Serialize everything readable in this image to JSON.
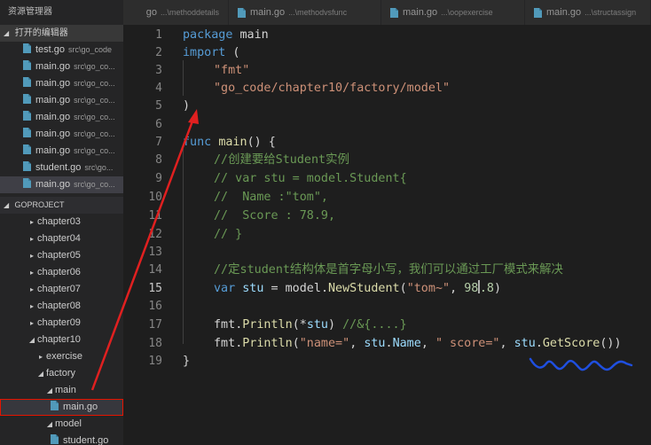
{
  "sidebar": {
    "header": "资源管理器",
    "open_editors_title": "打开的编辑器",
    "open_editors": [
      {
        "name": "test.go",
        "desc": "src\\go_code"
      },
      {
        "name": "main.go",
        "desc": "src\\go_co..."
      },
      {
        "name": "main.go",
        "desc": "src\\go_co..."
      },
      {
        "name": "main.go",
        "desc": "src\\go_co..."
      },
      {
        "name": "main.go",
        "desc": "src\\go_co..."
      },
      {
        "name": "main.go",
        "desc": "src\\go_co..."
      },
      {
        "name": "main.go",
        "desc": "src\\go_co..."
      },
      {
        "name": "student.go",
        "desc": "src\\go..."
      },
      {
        "name": "main.go",
        "desc": "src\\go_co..."
      }
    ],
    "project_title": "GOPROJECT",
    "tree": [
      {
        "label": "chapter03",
        "arrow": "▸"
      },
      {
        "label": "chapter04",
        "arrow": "▸"
      },
      {
        "label": "chapter05",
        "arrow": "▸"
      },
      {
        "label": "chapter06",
        "arrow": "▸"
      },
      {
        "label": "chapter07",
        "arrow": "▸"
      },
      {
        "label": "chapter08",
        "arrow": "▸"
      },
      {
        "label": "chapter09",
        "arrow": "▸"
      },
      {
        "label": "chapter10",
        "arrow": "◢"
      },
      {
        "label": "exercise",
        "arrow": "▸"
      },
      {
        "label": "factory",
        "arrow": "◢"
      },
      {
        "label": "main",
        "arrow": "◢"
      },
      {
        "label": "main.go"
      },
      {
        "label": "model",
        "arrow": "◢"
      },
      {
        "label": "student.go"
      }
    ]
  },
  "tabs": [
    {
      "name": "go",
      "desc": "...\\methoddetails"
    },
    {
      "name": "main.go",
      "desc": "...\\methodvsfunc"
    },
    {
      "name": "main.go",
      "desc": "...\\oopexercise"
    },
    {
      "name": "main.go",
      "desc": "...\\structassign"
    }
  ],
  "editor": {
    "active_line": 15,
    "line_numbers": [
      "1",
      "2",
      "3",
      "4",
      "5",
      "6",
      "7",
      "8",
      "9",
      "10",
      "11",
      "12",
      "13",
      "14",
      "15",
      "16",
      "17",
      "18",
      "19"
    ],
    "lines": {
      "l1_kw": "package",
      "l1_rest": " main",
      "l2_kw": "import",
      "l2_rest": " (",
      "l3_str": "\"fmt\"",
      "l4_str": "\"go_code/chapter10/factory/model\"",
      "l5": ")",
      "l7_kw": "func",
      "l7_fn": "main",
      "l7_rest": "() {",
      "l8_cm": "//创建要给Student实例",
      "l9_cm": "// var stu = model.Student{",
      "l10_cm": "//  Name :\"tom\",",
      "l11_cm": "//  Score : 78.9,",
      "l12_cm": "// }",
      "l14_cm": "//定student结构体是首字母小写，我们可以通过工厂模式来解决",
      "l15_kw": "var",
      "l15_var": "stu",
      "l15_eq": " = ",
      "l15_pkg": "model",
      "l15_dot": ".",
      "l15_fn": "NewStudent",
      "l15_open": "(",
      "l15_str": "\"tom~\"",
      "l15_comma": ", ",
      "l15_num1": "98",
      "l15_num2": ".8",
      "l15_close": ")",
      "l17_pkg": "fmt",
      "l17_dot": ".",
      "l17_fn": "Println",
      "l17_open": "(*",
      "l17_var": "stu",
      "l17_close": ") ",
      "l17_cm": "//&{....}",
      "l18_pkg": "fmt",
      "l18_dot": ".",
      "l18_fn": "Println",
      "l18_open": "(",
      "l18_str1": "\"name=\"",
      "l18_c1": ", ",
      "l18_var1": "stu",
      "l18_d1": ".",
      "l18_var2": "Name",
      "l18_c2": ", ",
      "l18_str2": "\" score=\"",
      "l18_c3": ", ",
      "l18_var3": "stu",
      "l18_d2": ".",
      "l18_fn2": "GetScore",
      "l18_close": "())",
      "l19": "}"
    }
  },
  "colors": {
    "annotation_red": "#e02020",
    "annotation_blue": "#1f4fe0"
  }
}
